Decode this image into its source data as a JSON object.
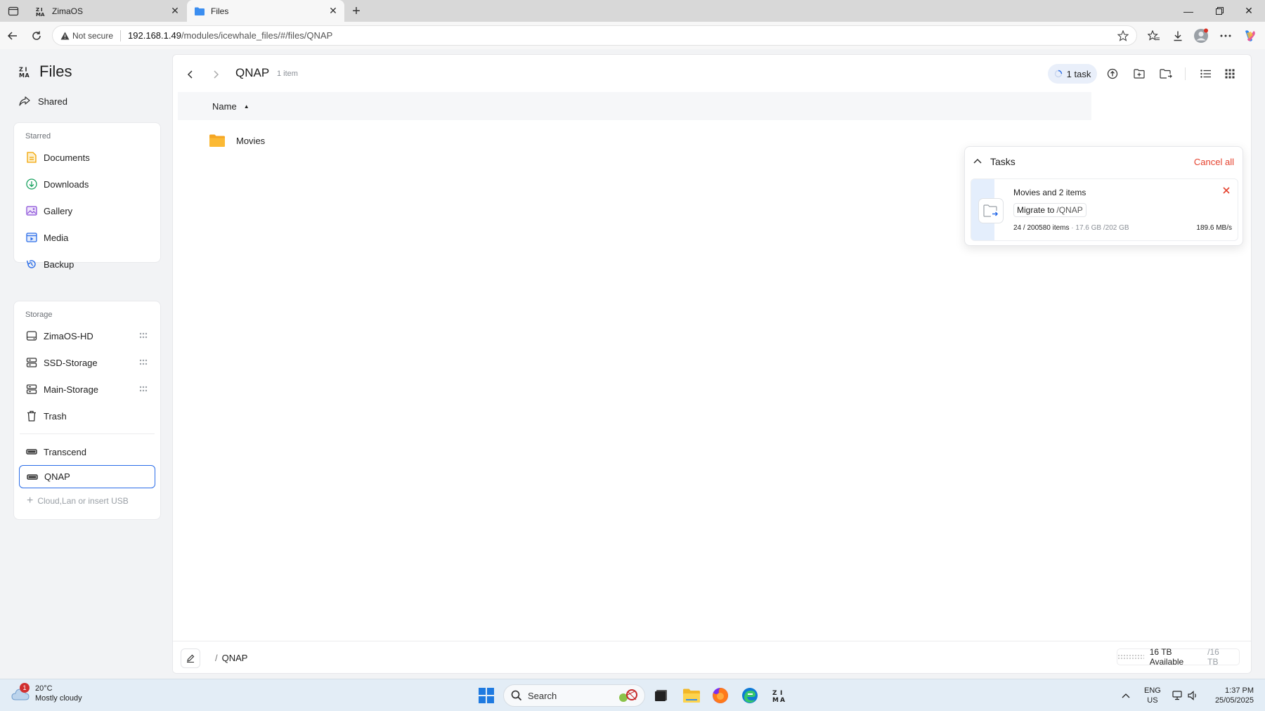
{
  "browser": {
    "tabs": [
      {
        "title": "ZimaOS",
        "active": false
      },
      {
        "title": "Files",
        "active": true
      }
    ],
    "security_label": "Not secure",
    "url_host": "192.168.1.49",
    "url_path": "/modules/icewhale_files/#/files/QNAP"
  },
  "sidebar": {
    "app_title": "Files",
    "shared_label": "Shared",
    "starred_heading": "Starred",
    "starred_items": [
      {
        "label": "Documents",
        "icon": "document-icon",
        "color": "#f2a300"
      },
      {
        "label": "Downloads",
        "icon": "download-icon",
        "color": "#1aa260"
      },
      {
        "label": "Gallery",
        "icon": "gallery-icon",
        "color": "#8a4fd8"
      },
      {
        "label": "Media",
        "icon": "media-icon",
        "color": "#2a6ce8"
      },
      {
        "label": "Backup",
        "icon": "backup-icon",
        "color": "#2a6ce8"
      }
    ],
    "storage_heading": "Storage",
    "storage_items": [
      {
        "label": "ZimaOS-HD",
        "icon": "drive-icon"
      },
      {
        "label": "SSD-Storage",
        "icon": "server-icon"
      },
      {
        "label": "Main-Storage",
        "icon": "server-icon"
      },
      {
        "label": "Trash",
        "icon": "trash-icon"
      }
    ],
    "external_items": [
      {
        "label": "Transcend",
        "icon": "usb-drive-icon",
        "selected": false
      },
      {
        "label": "QNAP",
        "icon": "usb-drive-icon",
        "selected": true
      }
    ],
    "add_location_label": "Cloud,Lan or insert USB"
  },
  "main": {
    "folder_title": "QNAP",
    "item_count": "1 item",
    "task_pill": "1 task",
    "column_name": "Name",
    "rows": [
      {
        "name": "Movies",
        "icon": "folder-icon"
      }
    ],
    "path_label": "QNAP",
    "capacity_available": "16 TB Available",
    "capacity_total": "/16 TB"
  },
  "tasks_panel": {
    "title": "Tasks",
    "cancel_all": "Cancel all",
    "task": {
      "name": "Movies and 2 items",
      "verb": "Migrate to",
      "destination": "/QNAP",
      "items_progress": "24 / 200580 items",
      "size_progress": "· 17.6 GB /202 GB",
      "speed": "189.6 MB/s",
      "progress_fraction": 0.087
    }
  },
  "taskbar": {
    "weather_badge": "1",
    "temperature": "20°C",
    "weather_text": "Mostly cloudy",
    "search_placeholder": "Search",
    "lang_top": "ENG",
    "lang_bottom": "US",
    "time": "1:37 PM",
    "date": "25/05/2025"
  },
  "colors": {
    "accent": "#2a6ce8",
    "danger": "#e5412d",
    "folder": "#f5a623"
  }
}
